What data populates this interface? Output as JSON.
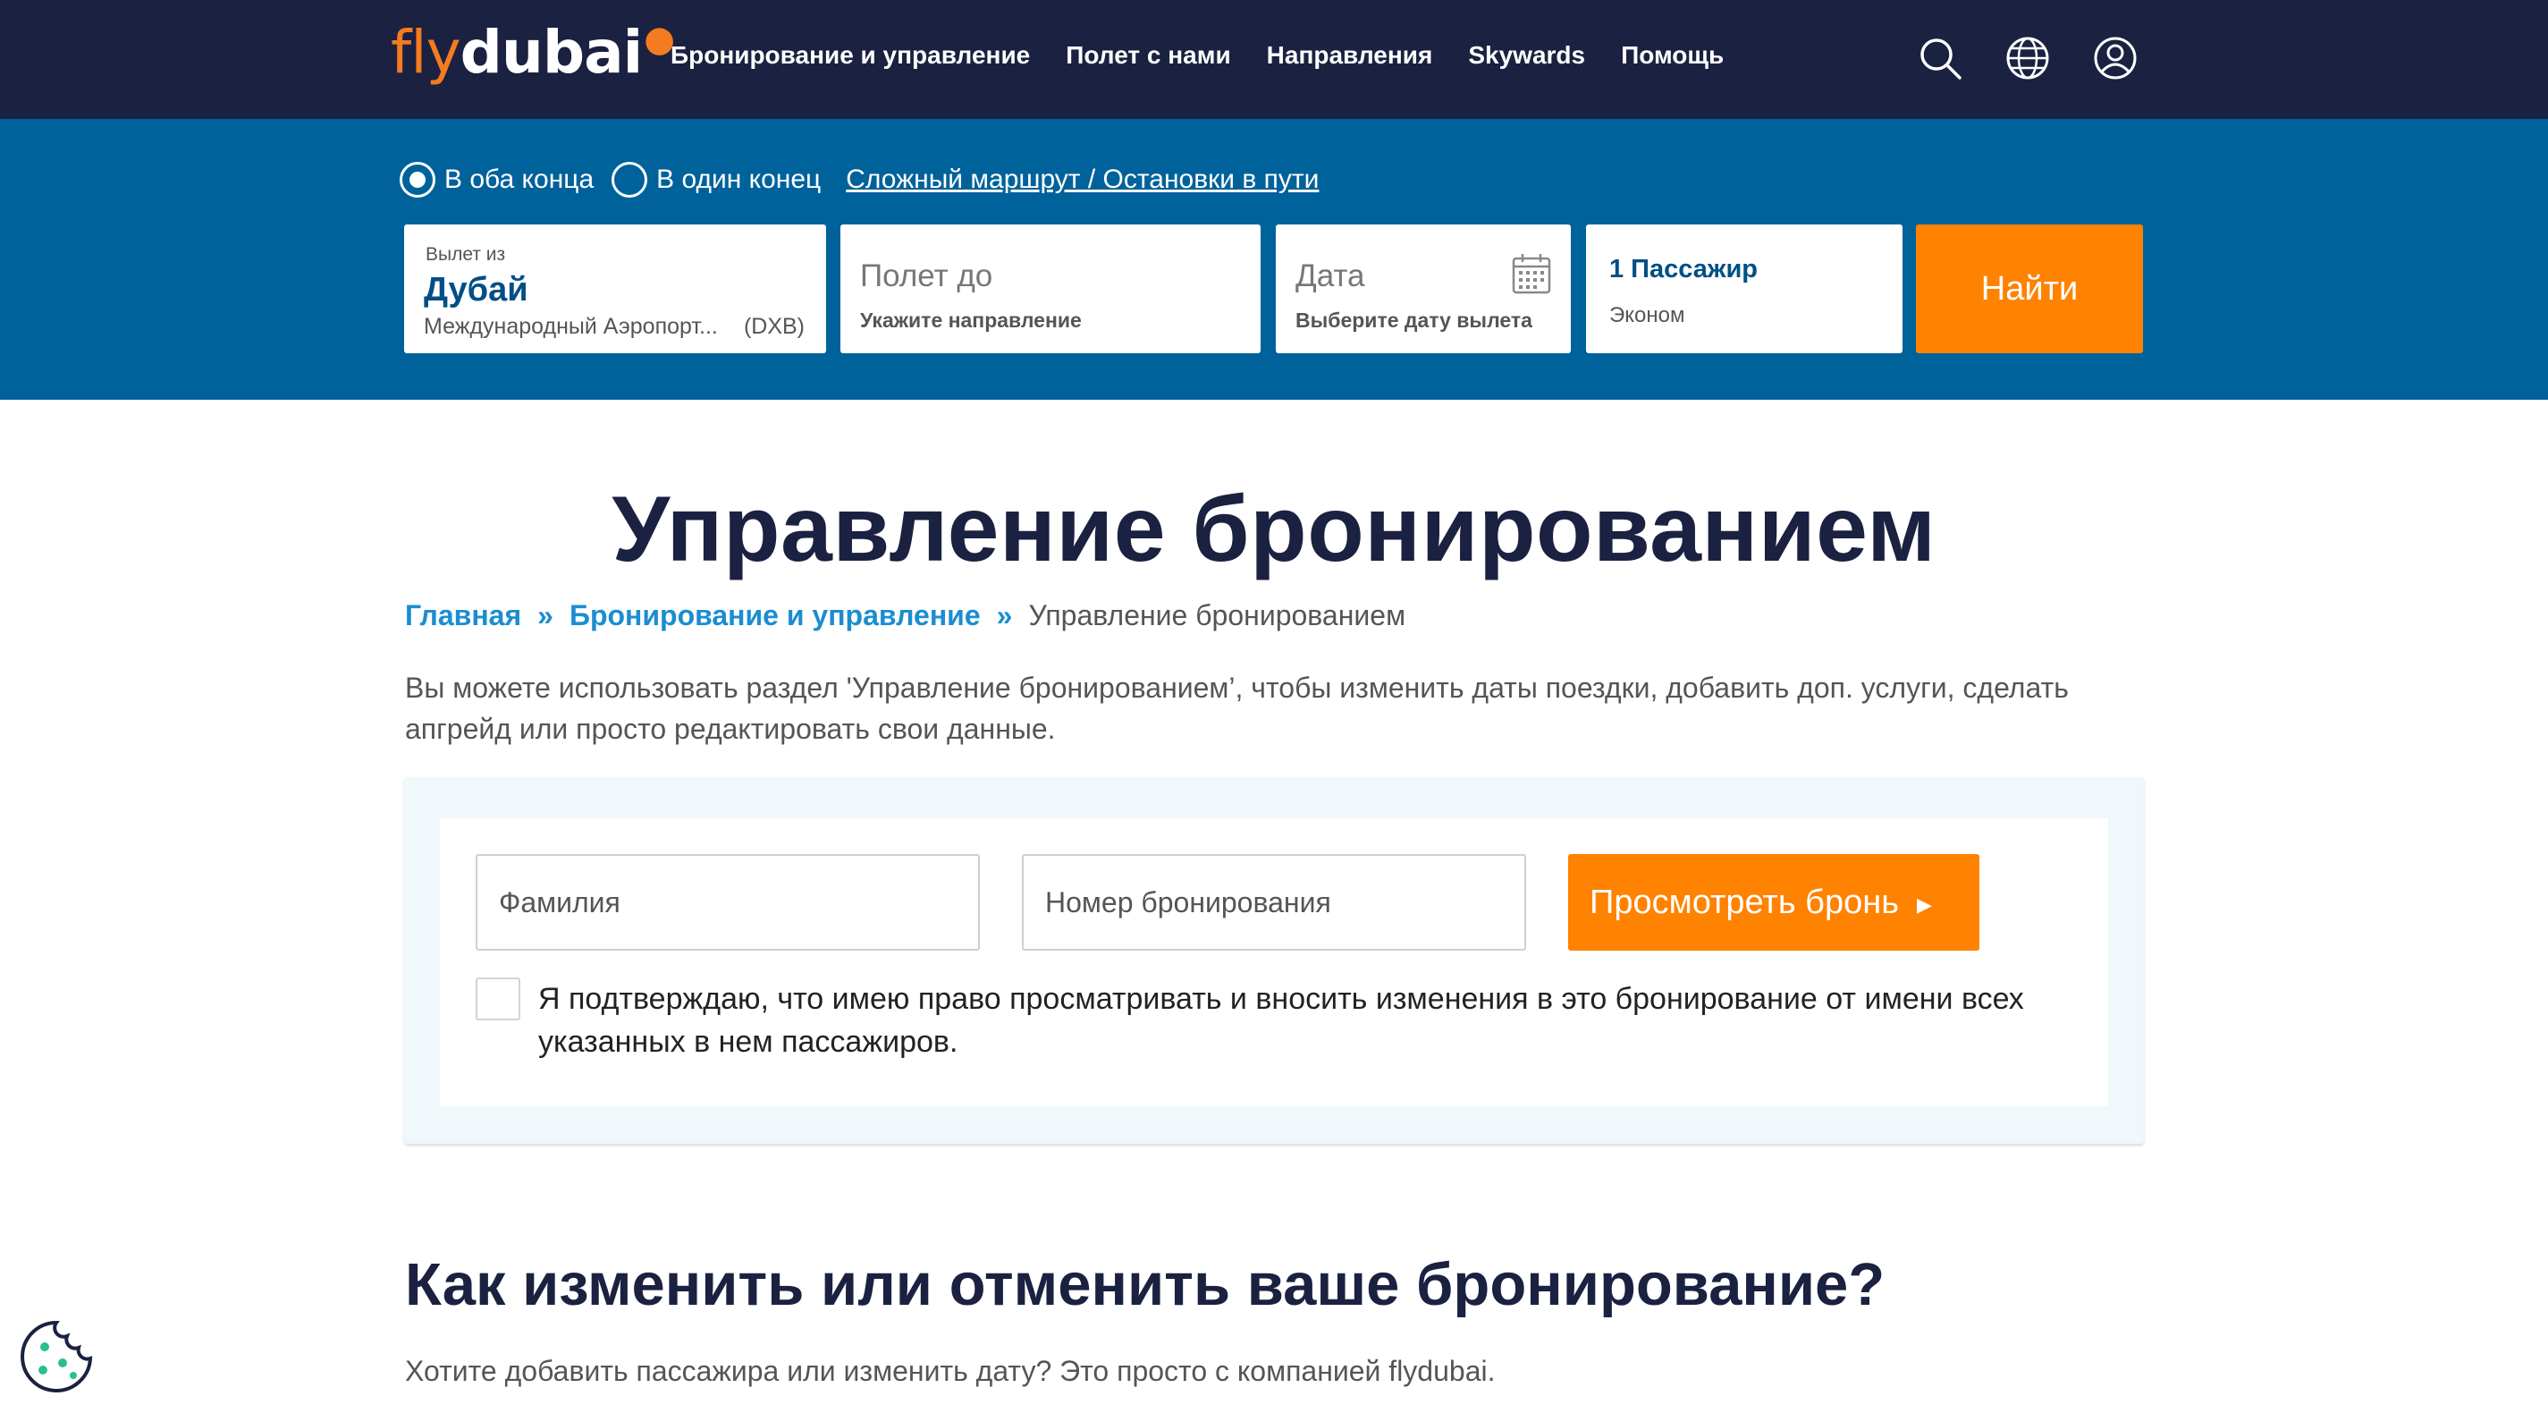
{
  "nav": {
    "logo_fly": "fly",
    "logo_dubai": "dubai",
    "links": [
      "Бронирование и управление",
      "Полет с нами",
      "Направления",
      "Skywards",
      "Помощь"
    ],
    "icons": [
      "search-icon",
      "globe-icon",
      "user-icon"
    ]
  },
  "search": {
    "trip_round": "В оба конца",
    "trip_oneway": "В один конец",
    "trip_multi": "Сложный маршрут / Остановки в пути",
    "from_label": "Вылет из",
    "from_city": "Дубай",
    "from_airport": "Международный Аэропорт...",
    "from_code": "(DXB)",
    "to_placeholder": "Полет до",
    "to_hint": "Укажите направление",
    "date_placeholder": "Дата",
    "date_hint": "Выберите дату вылета",
    "passengers": "1 Пассажир",
    "cabin": "Эконом",
    "find_button": "Найти"
  },
  "page": {
    "title": "Управление бронированием",
    "breadcrumb": {
      "home": "Главная",
      "sep": "»",
      "section": "Бронирование и управление",
      "current": "Управление бронированием"
    },
    "intro": "Вы можете использовать раздел 'Управление бронированием’, чтобы изменить даты поездки, добавить доп. услуги, сделать апгрейд или просто редактировать свои данные."
  },
  "manage_form": {
    "last_name_placeholder": "Фамилия",
    "booking_ref_placeholder": "Номер бронирования",
    "view_button": "Просмотреть бронь",
    "consent_text": "Я подтверждаю, что имею право просматривать и вносить изменения в это бронирование от имени всех указанных в нем пассажиров."
  },
  "faq": {
    "heading": "Как изменить или отменить ваше бронирование?",
    "text": "Хотите добавить пассажира или изменить дату? Это просто с компанией flydubai."
  },
  "colors": {
    "nav_bg": "#1b2140",
    "search_bg": "#00629b",
    "accent": "#ff8200",
    "link": "#1b8dd1"
  }
}
